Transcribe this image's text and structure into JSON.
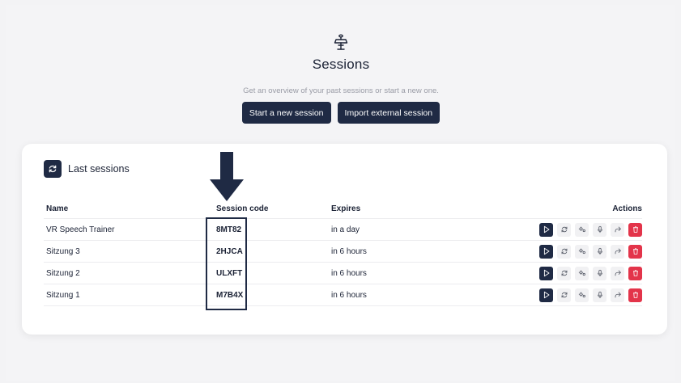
{
  "header": {
    "title": "Sessions",
    "subtitle": "Get an overview of your past sessions or start a new one.",
    "start_label": "Start a new session",
    "import_label": "Import external session",
    "icon": "podium-icon"
  },
  "last_sessions": {
    "title": "Last sessions",
    "columns": {
      "name": "Name",
      "code": "Session code",
      "expires": "Expires",
      "actions": "Actions"
    },
    "rows": [
      {
        "name": "VR Speech Trainer",
        "code": "8MT82",
        "expires": "in a day"
      },
      {
        "name": "Sitzung 3",
        "code": "2HJCA",
        "expires": "in 6 hours"
      },
      {
        "name": "Sitzung 2",
        "code": "ULXFT",
        "expires": "in 6 hours"
      },
      {
        "name": "Sitzung 1",
        "code": "M7B4X",
        "expires": "in 6 hours"
      }
    ],
    "row_actions": [
      "play-icon",
      "refresh-icon",
      "settings-icon",
      "microphone-icon",
      "share-icon",
      "trash-icon"
    ]
  },
  "colors": {
    "accent": "#1f2a44",
    "danger": "#e3344a",
    "background": "#f4f4f6"
  }
}
